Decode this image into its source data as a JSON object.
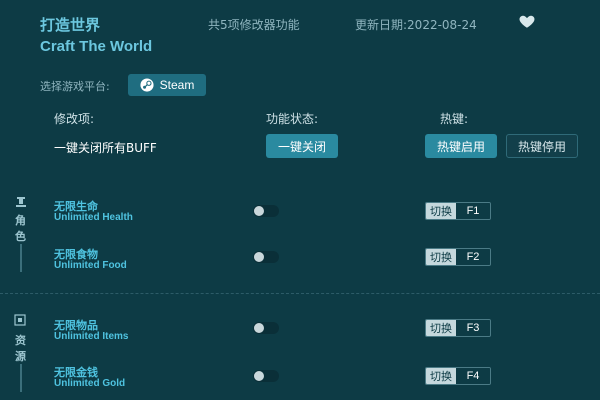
{
  "header": {
    "title_cn": "打造世界",
    "feature_count": "共5项修改器功能",
    "update_date": "更新日期:2022-08-24",
    "title_en": "Craft The World"
  },
  "platform": {
    "label": "选择游戏平台:",
    "steam_label": "Steam"
  },
  "columns": {
    "modifier": "修改项:",
    "status": "功能状态:",
    "hotkey": "热键:"
  },
  "global": {
    "label": "一键关闭所有BUFF",
    "close_all_label": "一键关闭",
    "enable_hotkeys_label": "热键启用",
    "disable_hotkeys_label": "热键停用"
  },
  "sections": [
    {
      "chars": [
        "角",
        "色"
      ]
    },
    {
      "chars": [
        "资",
        "源"
      ]
    }
  ],
  "items": [
    {
      "name_cn": "无限生命",
      "name_en": "Unlimited Health",
      "action": "切换",
      "key": "F1"
    },
    {
      "name_cn": "无限食物",
      "name_en": "Unlimited Food",
      "action": "切换",
      "key": "F2"
    },
    {
      "name_cn": "无限物品",
      "name_en": "Unlimited Items",
      "action": "切换",
      "key": "F3"
    },
    {
      "name_cn": "无限金钱",
      "name_en": "Unlimited Gold",
      "action": "切换",
      "key": "F4"
    }
  ],
  "colors": {
    "background": "#0d3b45",
    "accent": "#4fc3e0",
    "button": "#2a8aa0"
  }
}
